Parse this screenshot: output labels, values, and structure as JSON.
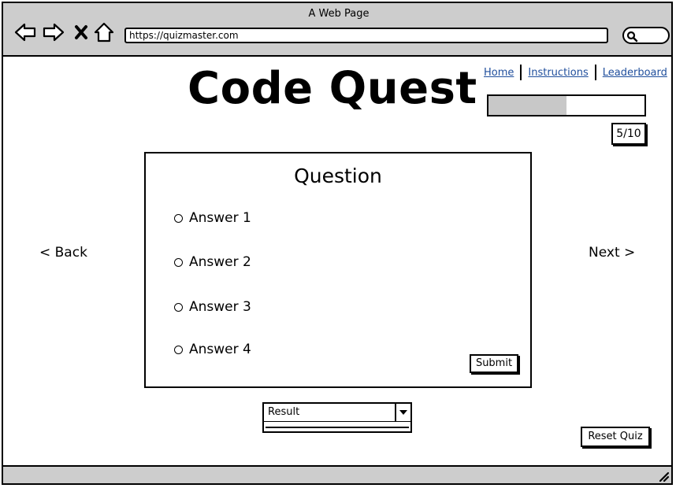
{
  "window": {
    "title": "A Web Page",
    "url": "https://quizmaster.com"
  },
  "header": {
    "title": "Code Quest",
    "nav": [
      {
        "label": "Home"
      },
      {
        "label": "Instructions"
      },
      {
        "label": "Leaderboard"
      }
    ],
    "progress": {
      "fraction": 0.5,
      "label": "5/10"
    }
  },
  "question": {
    "title": "Question",
    "answers": [
      {
        "label": "Answer 1"
      },
      {
        "label": "Answer 2"
      },
      {
        "label": "Answer 3"
      },
      {
        "label": "Answer 4"
      }
    ],
    "submit_label": "Submit"
  },
  "navigation": {
    "back_label": "< Back",
    "next_label": "Next >"
  },
  "result": {
    "selected": "Result"
  },
  "reset_label": "Reset Quiz",
  "icons": {
    "back": "arrow-left-icon",
    "forward": "arrow-right-icon",
    "stop": "close-icon",
    "home": "home-icon",
    "search": "search-icon",
    "dropdown": "caret-down-icon",
    "resize": "resize-grip-icon"
  }
}
